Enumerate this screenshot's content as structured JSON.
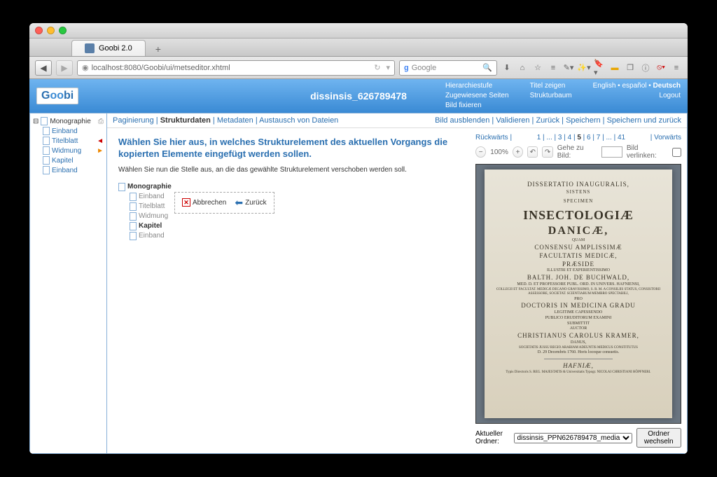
{
  "browser": {
    "tab_title": "Goobi 2.0",
    "url": "localhost:8080/Goobi/ui/metseditor.xhtml",
    "search_placeholder": "Google"
  },
  "header": {
    "logo_text": "Goobi",
    "process_title": "dissinsis_626789478",
    "links_col1": [
      "Hierarchiestufe",
      "Zugewiesene Seiten",
      "Bild fixieren"
    ],
    "links_col2": [
      "Titel zeigen",
      "Strukturbaum"
    ],
    "languages": "English • español • Deutsch",
    "logout": "Logout"
  },
  "sidebar": {
    "root": "Monographie",
    "items": [
      "Einband",
      "Titelblatt",
      "Widmung",
      "Kapitel",
      "Einband"
    ]
  },
  "tabs": {
    "items": [
      "Paginierung",
      "Strukturdaten",
      "Metadaten",
      "Austausch von Dateien"
    ],
    "right": [
      "Bild ausblenden",
      "Validieren",
      "Zurück",
      "Speichern",
      "Speichern und zurück"
    ]
  },
  "main": {
    "heading": "Wählen Sie hier aus, in welches Strukturelement des aktuellen Vorgangs die kopierten Elemente eingefügt werden sollen.",
    "subtext": "Wählen Sie nun die Stelle aus, an die das gewählte Strukturelement verschoben werden soll.",
    "tree_root": "Monographie",
    "tree_items": [
      "Einband",
      "Titelblatt",
      "Widmung",
      "Kapitel",
      "Einband"
    ],
    "abort": "Abbrechen",
    "back": "Zurück"
  },
  "viewer": {
    "backward": "Rückwärts",
    "pages": "1 | ... | 3 | 4 | 5 | 6 | 7 | ... | 41",
    "forward": "Vorwärts",
    "zoom": "100%",
    "goto_label": "Gehe zu Bild:",
    "link_label": "Bild verlinken:",
    "folder_label": "Aktueller Ordner:",
    "folder_value": "dissinsis_PPN626789478_media",
    "folder_button": "Ordner wechseln",
    "scan": {
      "l1": "DISSERTATIO INAUGURALIS,",
      "l2a": "SISTENS",
      "l2b": "SPECIMEN",
      "big1": "INSECTOLOGIÆ",
      "big2": "DANICÆ,",
      "l3": "QUAM",
      "l4": "CONSENSU AMPLISSIMÆ",
      "l5": "FACULTATIS MEDICÆ,",
      "l6": "PRÆSIDE",
      "l7": "ILLUSTRI ET EXPERIENTISSIMO",
      "name1": "BALTH. JOH. DE BUCHWALD,",
      "sub1": "MED. D. ET PROFESSORE PUBL. ORD. IN UNIVERS. HAFNIENSI,",
      "sub2": "COLLEGII ET FACULTAT. MEDICÆ DECANO GRAVISSIMO, S. R. M. A CONSILIIS STATUS, CONSISTORII ASSESSORE, SOCIETAT. SCIENTIARUM MEMBRO SPECTABILI,",
      "l8": "PRO",
      "l9": "DOCTORIS IN MEDICINA GRADU",
      "l10": "LEGITIME CAPESSENDO",
      "l11": "PUBLICO ERUDITORUM EXAMINI",
      "l12": "SUBMITTIT",
      "l13": "AUCTOR",
      "name2": "CHRISTIANUS CAROLUS KRAMER,",
      "sub3": "DANUS,",
      "sub4": "SOCIETATIS JUSSU REGIO ARABIAM ADEUNTIS MEDICUS CONSTITUTUS",
      "date": "D. 29 Decembris 1760. Horis locoque consuetis.",
      "place": "HAFNIÆ,",
      "printer": "Typis Directoris S. REG. MAJESTATIS & Universitatis Typogr. NICOLAI CHRISTIANI HÖPFNERI."
    }
  }
}
